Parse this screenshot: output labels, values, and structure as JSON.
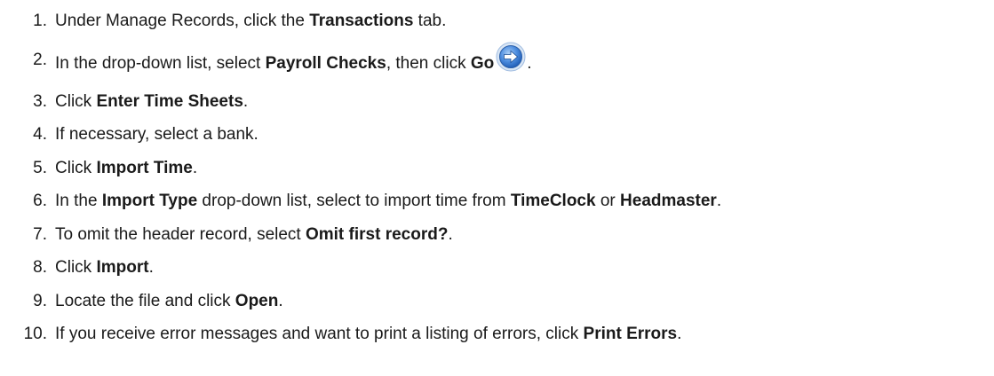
{
  "steps": [
    {
      "number": "1.",
      "parts": [
        "Under Manage Records, click the ",
        "Transactions",
        " tab."
      ]
    },
    {
      "number": "2.",
      "parts": [
        "In the drop-down list, select ",
        "Payroll Checks",
        ", then click ",
        "Go",
        "."
      ]
    },
    {
      "number": "3.",
      "parts": [
        "Click ",
        "Enter Time Sheets",
        "."
      ]
    },
    {
      "number": "4.",
      "parts": [
        "If necessary, select a bank."
      ]
    },
    {
      "number": "5.",
      "parts": [
        "Click ",
        "Import Time",
        "."
      ]
    },
    {
      "number": "6.",
      "parts": [
        "In the ",
        "Import Type",
        " drop-down list, select to import time from ",
        "TimeClock",
        " or ",
        "Headmaster",
        "."
      ]
    },
    {
      "number": "7.",
      "parts": [
        "To omit the header record, select ",
        "Omit first record?",
        "."
      ]
    },
    {
      "number": "8.",
      "parts": [
        "Click ",
        "Import",
        "."
      ]
    },
    {
      "number": "9.",
      "parts": [
        "Locate the file and click ",
        "Open",
        "."
      ]
    },
    {
      "number": "10.",
      "parts": [
        "If you receive error messages and want to print a listing of errors, click ",
        "Print Errors",
        "."
      ]
    }
  ],
  "icons": {
    "go": "arrow-right-circle-icon"
  },
  "colors": {
    "icon_fill": "#3f82d8",
    "icon_ring": "#cfe0f5",
    "text": "#1a1a1a"
  }
}
